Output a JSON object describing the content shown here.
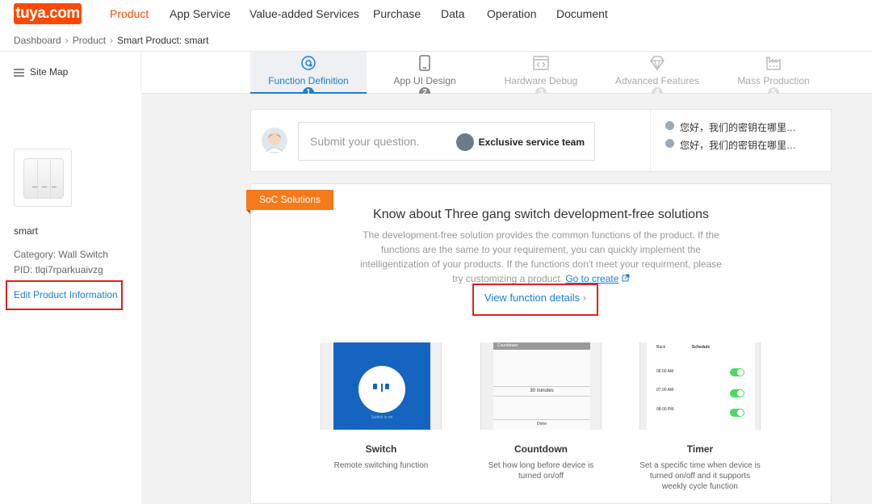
{
  "logo": {
    "text": "tuya.com"
  },
  "nav": {
    "items": [
      "Product",
      "App Service",
      "Value-added Services",
      "Purchase",
      "Data",
      "Operation",
      "Document"
    ],
    "active": "Product"
  },
  "breadcrumb": {
    "items": [
      "Dashboard",
      "Product",
      "Smart Product: smart"
    ]
  },
  "sitemap": {
    "label": "Site Map"
  },
  "steps": [
    {
      "label": "Function Definition",
      "num": "1",
      "state": "active",
      "icon": "gear-icon"
    },
    {
      "label": "App UI Design",
      "num": "2",
      "state": "done",
      "icon": "phone-icon"
    },
    {
      "label": "Hardware Debug",
      "num": "3",
      "state": "pending",
      "icon": "code-icon"
    },
    {
      "label": "Advanced Features",
      "num": "4",
      "state": "pending",
      "icon": "diamond-icon"
    },
    {
      "label": "Mass Production",
      "num": "5",
      "state": "pending",
      "icon": "factory-icon"
    }
  ],
  "product": {
    "name": "smart",
    "category": "Category: Wall Switch",
    "pid": "PID: tlqi7rparkuaivzg",
    "edit_label": "Edit Product Information"
  },
  "question": {
    "placeholder": "Submit your question.",
    "team_label": "Exclusive service team",
    "faqs": [
      "您好，我们的密钥在哪里…",
      "您好，我们的密钥在哪里…"
    ]
  },
  "solutions": {
    "tag": "SoC Solutions",
    "title": "Know about Three gang switch development-free solutions",
    "description": "The development-free solution provides the common functions of the product. If the functions are the same to your requirement, you can quickly implement the intelligentization of your products. If the functions don't meet your requirment, please try customizing a product.",
    "create_link": "Go to create",
    "view_details": "View function details",
    "features": [
      {
        "name": "Switch",
        "desc": "Remote switching function",
        "screen": {
          "caption": "Switch is on"
        }
      },
      {
        "name": "Countdown",
        "desc": "Set how long before device  is turned on/off",
        "screen": {
          "title": "Countdown",
          "value": "30 minutes",
          "done": "Done"
        }
      },
      {
        "name": "Timer",
        "desc": "Set a specific time when device is turned on/off and it supports weekly cycle function",
        "screen": {
          "back": "Back",
          "title": "Schedule",
          "times": [
            "06:00 AM",
            "07:00 AM",
            "08:00 PM"
          ]
        }
      }
    ]
  },
  "colors": {
    "brand": "#ff4800",
    "link": "#1b7dd6",
    "highlight_box": "#e02020",
    "soc_tag": "#f57a1c",
    "switch_blue": "#1565c0",
    "toggle_green": "#4cd964"
  }
}
